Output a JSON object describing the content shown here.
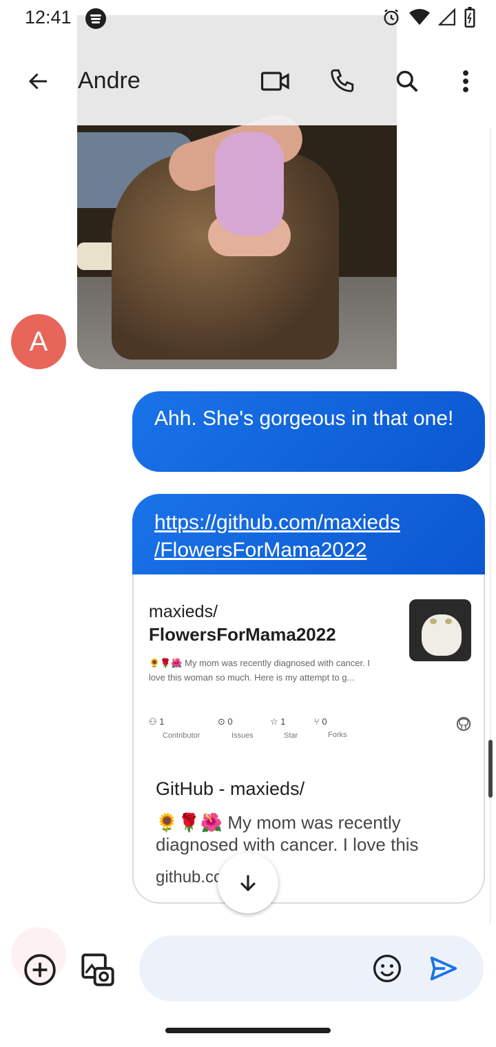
{
  "status": {
    "time": "12:41",
    "icons": [
      "spotify-icon",
      "alarm-icon",
      "wifi-icon",
      "signal-icon",
      "battery-icon"
    ]
  },
  "header": {
    "contact_name": "Andre",
    "actions": [
      "back-arrow-icon",
      "video-call-icon",
      "phone-icon",
      "search-icon",
      "more-vert-icon"
    ]
  },
  "thread": {
    "incoming_avatar_initial": "A",
    "outgoing": [
      {
        "text": "Ahh. She's gorgeous in that one!"
      },
      {
        "link": "https://github.com/maxieds/FlowersForMama2022",
        "link_line1": "https://github.com/maxieds",
        "link_line2": "/FlowersForMama2022"
      }
    ]
  },
  "preview": {
    "owner": "maxieds/",
    "repo": "FlowersForMama2022",
    "og_description": "🌻🌹🌺 My mom was recently diagnosed with cancer. I love this woman so much. Here is my attempt to g...",
    "stats": [
      {
        "num": "1",
        "label": "Contributor"
      },
      {
        "num": "0",
        "label": "Issues"
      },
      {
        "num": "1",
        "label": "Star"
      },
      {
        "num": "0",
        "label": "Forks"
      }
    ],
    "title": "GitHub - maxieds/",
    "description": "🌻🌹🌺 My mom was recently diagnosed with cancer. I love this",
    "domain": "github.co"
  },
  "composer": {
    "placeholder": "",
    "icons": [
      "add-circle-icon",
      "gallery-camera-icon",
      "emoji-icon",
      "send-icon"
    ]
  },
  "colors": {
    "bubble_out": "#1a73e8",
    "avatar": "#e8655a",
    "composer_bg": "#edf2fa",
    "send": "#1a73e8"
  }
}
